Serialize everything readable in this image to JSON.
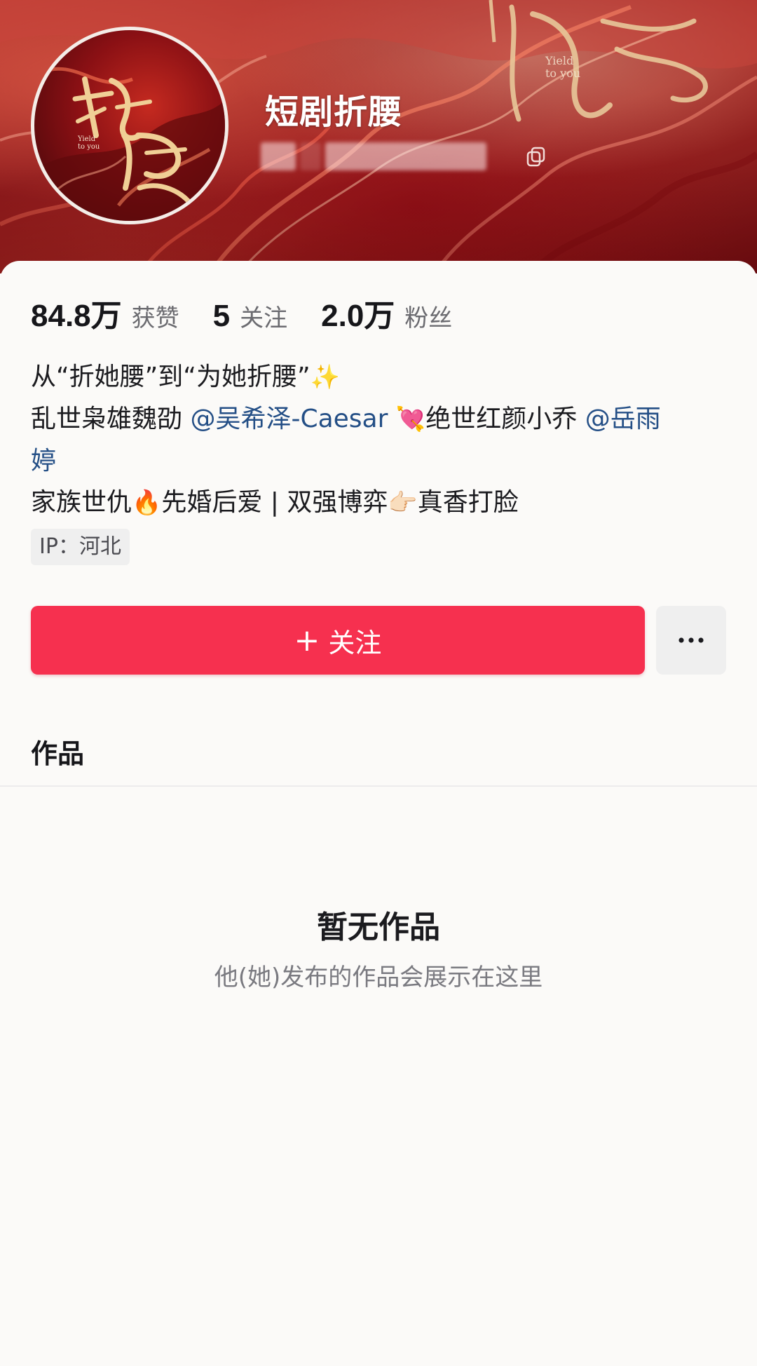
{
  "profile": {
    "name": "短剧折腰",
    "avatar_title": "折腰",
    "avatar_subtitle": "Yield\nto you",
    "banner_title": "腰",
    "banner_subtitle": "Yield\nto you"
  },
  "stats": [
    {
      "value": "84.8万",
      "label": "获赞"
    },
    {
      "value": "5",
      "label": "关注"
    },
    {
      "value": "2.0万",
      "label": "粉丝"
    }
  ],
  "bio": {
    "line1": "从“折她腰”到“为她折腰”",
    "line1_emoji": "✨",
    "line2_prefix": "乱世枭雄魏劭",
    "mention1": "@吴希泽-Caesar",
    "line2_emoji": "💘",
    "line2_middle": "绝世红颜小乔",
    "mention2_part1": "@岳雨",
    "mention2_part2": "婷",
    "line3_part1": "家族世仇",
    "line3_emoji1": "🔥",
    "line3_part2": "先婚后爱 | 双强博弈",
    "line3_emoji2": "👉🏻",
    "line3_part3": "真香打脸"
  },
  "ip": {
    "text": "IP：河北"
  },
  "actions": {
    "follow_plus": "+",
    "follow_label": "关注",
    "more_label": "..."
  },
  "tabs": {
    "works": "作品"
  },
  "empty": {
    "title": "暂无作品",
    "subtitle": "他(她)发布的作品会展示在这里"
  },
  "colors": {
    "follow_button": "#f6304f",
    "mention": "#244f86",
    "banner": "#9e1f1e"
  }
}
